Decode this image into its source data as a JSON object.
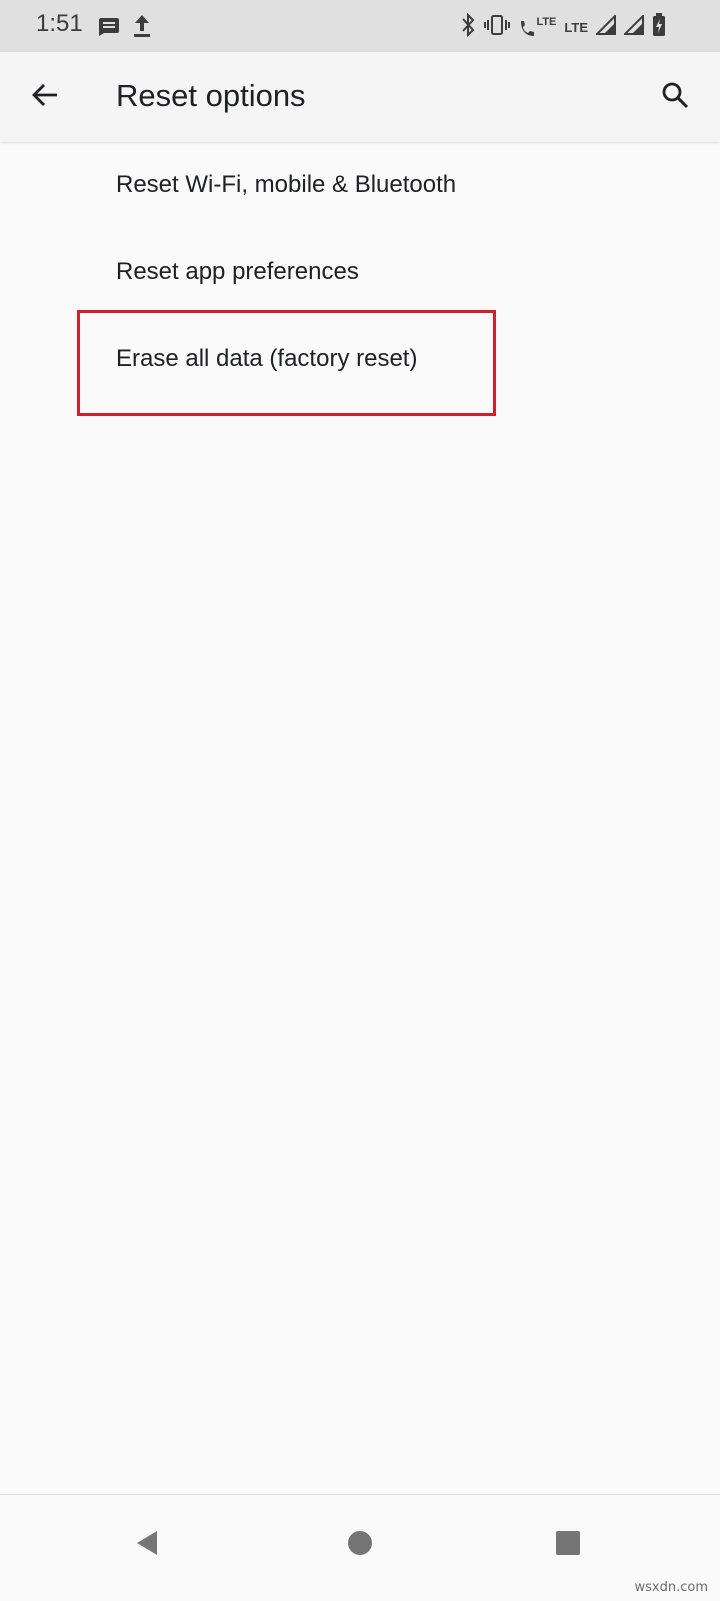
{
  "status_bar": {
    "time": "1:51",
    "left_icons": [
      "message-icon",
      "upload-icon"
    ],
    "right_icons": [
      "bluetooth-icon",
      "vibrate-icon",
      "volte-call-icon",
      "lte-icon",
      "signal-icon",
      "signal-icon",
      "battery-icon"
    ],
    "lte_small": "LTE",
    "lte": "LTE"
  },
  "app_bar": {
    "title": "Reset options",
    "back_icon": "arrow-back-icon",
    "search_icon": "search-icon"
  },
  "options": [
    {
      "label": "Reset Wi-Fi, mobile & Bluetooth"
    },
    {
      "label": "Reset app preferences"
    },
    {
      "label": "Erase all data (factory reset)"
    }
  ],
  "highlight_color": "#d11f2e",
  "nav_bar": {
    "buttons": [
      "back-triangle-icon",
      "home-circle-icon",
      "recents-square-icon"
    ]
  },
  "watermark": "wsxdn.com"
}
